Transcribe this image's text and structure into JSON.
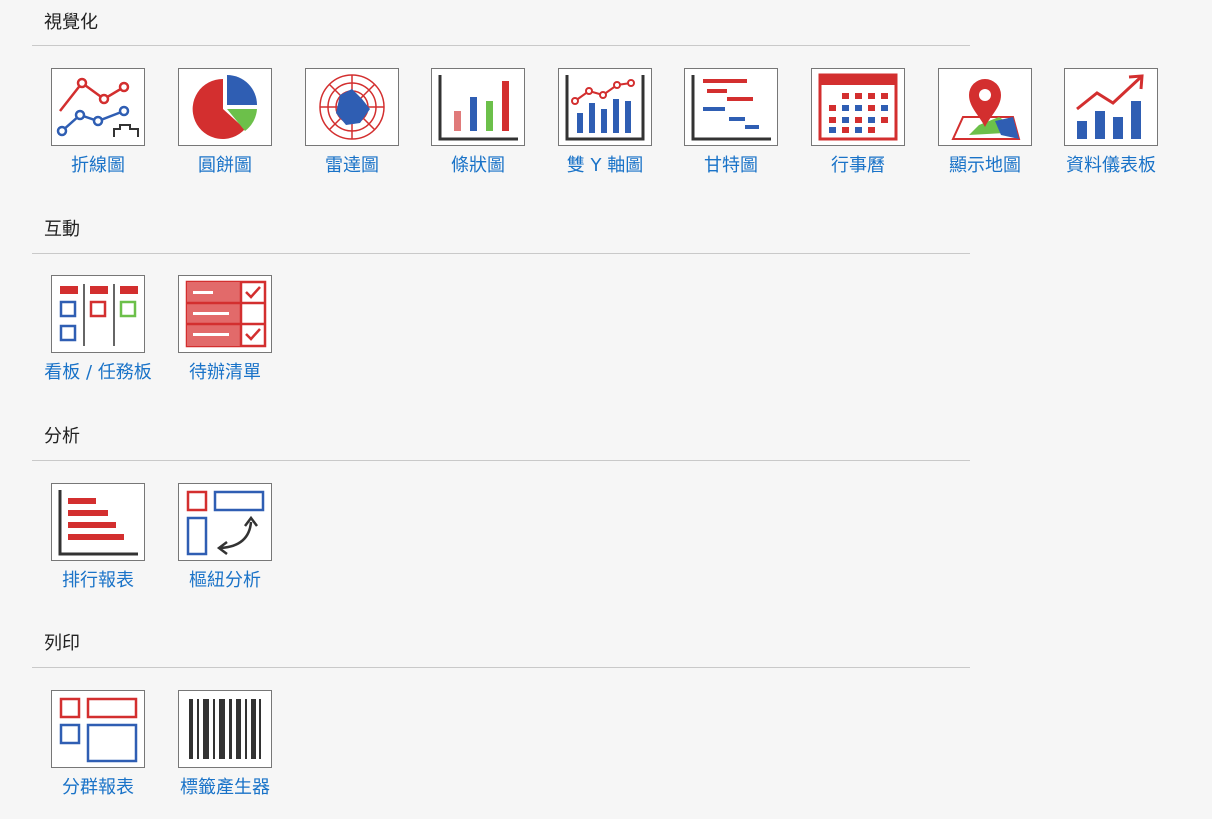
{
  "colors": {
    "red": "#d32f2f",
    "blue": "#2f5eb3",
    "green": "#6cc04a",
    "dark": "#333333",
    "link": "#1a73c8"
  },
  "sections": [
    {
      "title": "視覺化",
      "items": [
        {
          "label": "折線圖",
          "icon": "line-chart-icon"
        },
        {
          "label": "圓餅圖",
          "icon": "pie-chart-icon"
        },
        {
          "label": "雷達圖",
          "icon": "radar-chart-icon"
        },
        {
          "label": "條狀圖",
          "icon": "bar-chart-icon"
        },
        {
          "label": "雙 Y 軸圖",
          "icon": "dual-axis-chart-icon"
        },
        {
          "label": "甘特圖",
          "icon": "gantt-chart-icon"
        },
        {
          "label": "行事曆",
          "icon": "calendar-icon"
        },
        {
          "label": "顯示地圖",
          "icon": "map-pin-icon"
        },
        {
          "label": "資料儀表板",
          "icon": "dashboard-icon"
        }
      ]
    },
    {
      "title": "互動",
      "items": [
        {
          "label": "看板 / 任務板",
          "icon": "kanban-icon"
        },
        {
          "label": "待辦清單",
          "icon": "todo-list-icon"
        }
      ]
    },
    {
      "title": "分析",
      "items": [
        {
          "label": "排行報表",
          "icon": "ranking-report-icon"
        },
        {
          "label": "樞紐分析",
          "icon": "pivot-table-icon"
        }
      ]
    },
    {
      "title": "列印",
      "items": [
        {
          "label": "分群報表",
          "icon": "group-report-icon"
        },
        {
          "label": "標籤產生器",
          "icon": "barcode-icon"
        }
      ]
    }
  ]
}
